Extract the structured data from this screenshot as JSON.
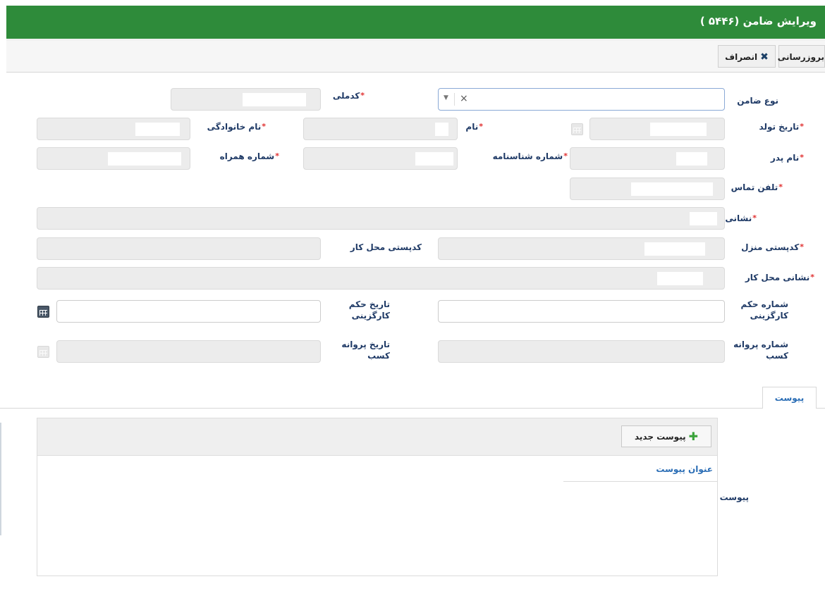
{
  "window": {
    "title": "ویرایش ضامن (۵۴۴۶ )"
  },
  "toolbar": {
    "update_label": "بروزرسانی",
    "cancel_label": "انصراف"
  },
  "form": {
    "guarantor_type_label": "نوع ضامن",
    "national_code_label": "کدملی",
    "birth_date_label": "تاریخ تولد",
    "first_name_label": "نام",
    "last_name_label": "نام خانوادگی",
    "father_name_label": "نام پدر",
    "id_number_label": "شماره شناسنامه",
    "mobile_label": "شماره همراه",
    "phone_label": "تلفن تماس",
    "address_label": "نشانی",
    "home_postal_label": "کدپستی منزل",
    "work_postal_label": "کدپستی محل کار",
    "work_address_label": "نشانی محل کار",
    "employment_order_number_label": "شماره حکم کارگزینی",
    "employment_order_date_label": "تاریخ حکم کارگزینی",
    "business_license_number_label": "شماره پروانه کسب",
    "business_license_date_label": "تاریخ پروانه کسب",
    "required_mark": "*"
  },
  "attachments": {
    "tab_label": "پیوست",
    "section_label": "پیوست",
    "new_button_label": "پیوست جدید",
    "column_title": "عنوان پیوست"
  },
  "colors": {
    "title_bar": "#2e8b3a",
    "label": "#1f3a66",
    "link": "#2a6db5",
    "required": "#e03030"
  }
}
